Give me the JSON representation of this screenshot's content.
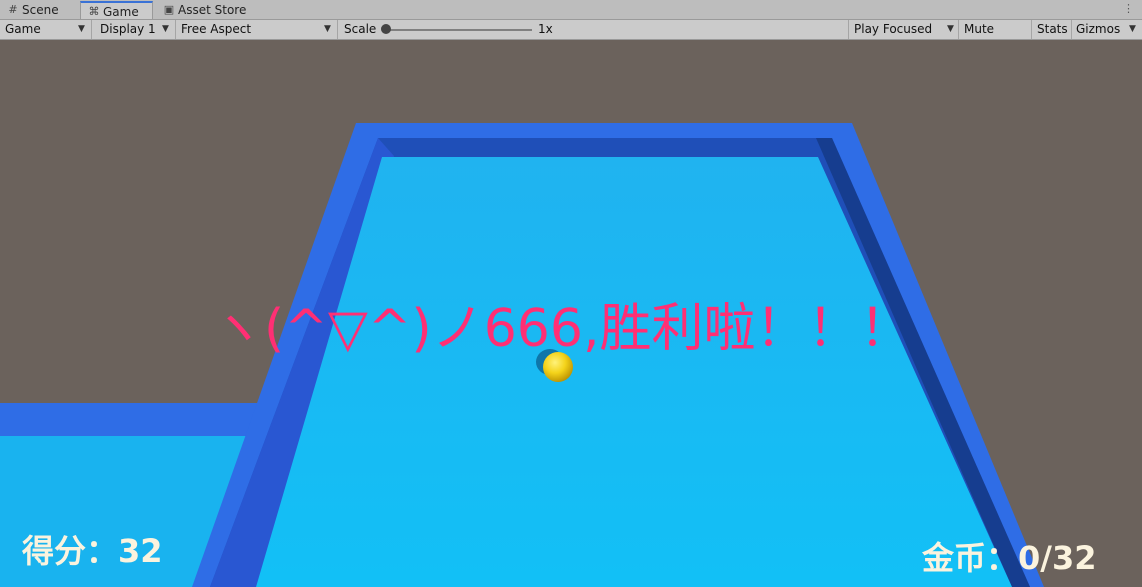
{
  "tabs": [
    {
      "label": "Scene",
      "icon": "grid-icon"
    },
    {
      "label": "Game",
      "icon": "gamepad-icon"
    },
    {
      "label": "Asset Store",
      "icon": "store-bag-icon"
    }
  ],
  "toolbar": {
    "view_select": "Game",
    "display_select": "Display 1",
    "aspect_select": "Free Aspect",
    "scale_label": "Scale",
    "scale_value": "1x",
    "scale_level": 0.0,
    "play_mode_select": "Play Focused",
    "mute_audio": "Mute Audio",
    "stats": "Stats",
    "gizmos": "Gizmos"
  },
  "game": {
    "victory_message": "ヽ(^▽^)ノ666,胜利啦！！！",
    "score_label": "得分：",
    "score_value": "32",
    "coins_label": "金币：",
    "coins_value": "0/32"
  },
  "colors": {
    "background": "#6b625c",
    "floor": "#1bb8f2",
    "wall": "#2f6de6",
    "message": "#ff2f74",
    "hud_text": "#fbf3de",
    "ball": "#f4d31a"
  }
}
